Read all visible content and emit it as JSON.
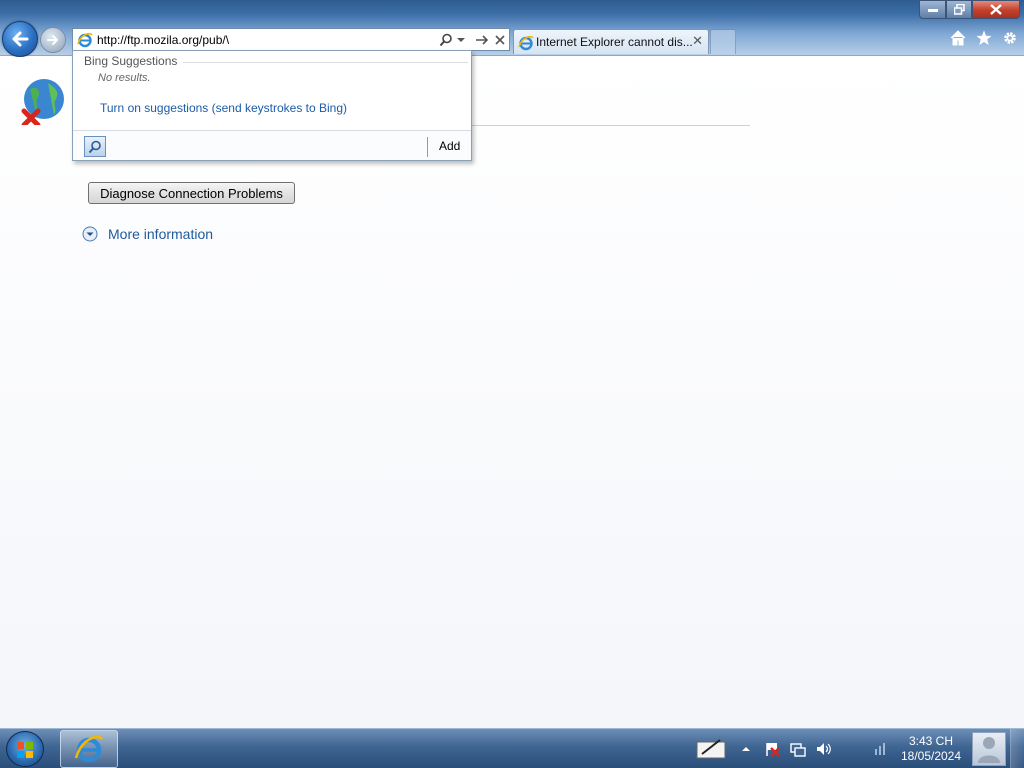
{
  "browser": {
    "address_url": "http://ftp.mozila.org/pub/\\",
    "tab_title": "Internet Explorer cannot dis...",
    "icons": [
      "back-icon",
      "forward-icon",
      "ie-icon",
      "search-icon",
      "dropdown-icon",
      "go-icon",
      "stop-icon",
      "close-icon",
      "home-icon",
      "favorites-star-icon",
      "settings-gear-icon"
    ]
  },
  "suggestions": {
    "header": "Bing Suggestions",
    "no_results": "No results.",
    "turn_on_link": "Turn on suggestions (send keystrokes to Bing)",
    "add_label": "Add"
  },
  "page": {
    "diagnose_button": "Diagnose Connection Problems",
    "more_info": "More information"
  },
  "taskbar": {
    "time": "3:43 CH",
    "date": "18/05/2024",
    "icons": [
      "start-orb-icon",
      "internet-explorer-icon",
      "pen-tablet-icon",
      "tray-arrow-icon",
      "action-center-flag-icon",
      "network-icon",
      "volume-icon",
      "input-indicator-icon",
      "user-icon"
    ]
  },
  "colors": {
    "link_blue": "#1f5a9c",
    "close_red": "#c2402b",
    "taskbar_blue": "#2b4e7a"
  }
}
